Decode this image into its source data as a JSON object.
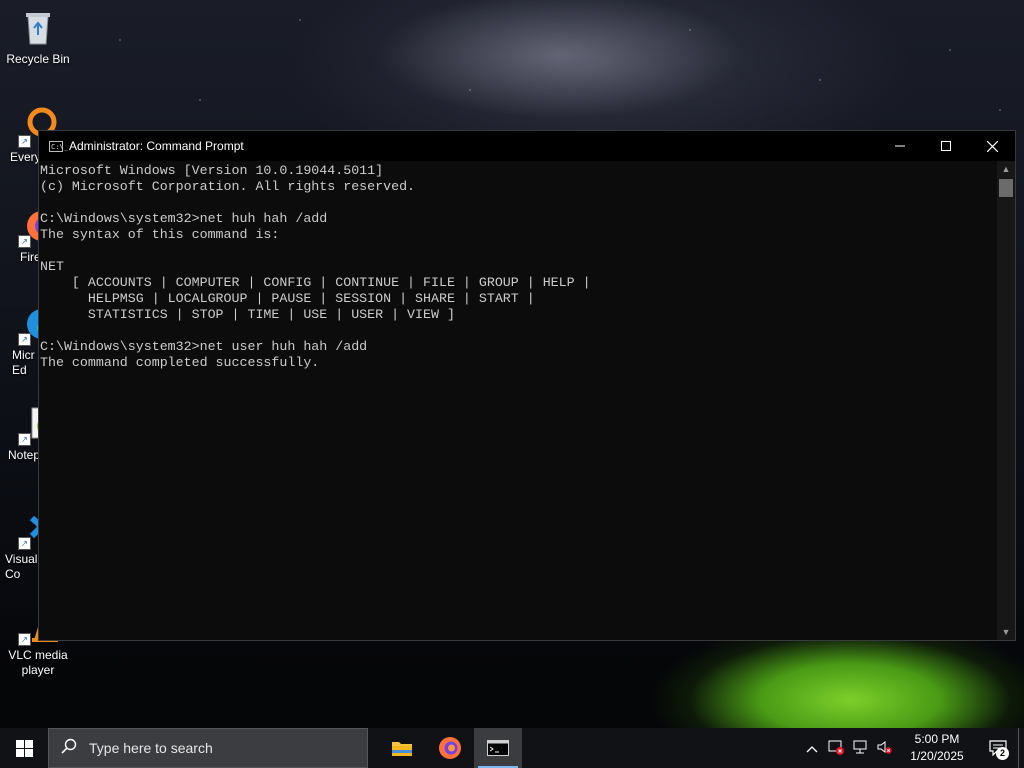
{
  "desktop": {
    "icons": [
      {
        "label": "Recycle Bin"
      },
      {
        "label": "Every"
      },
      {
        "label": "Fire"
      },
      {
        "label": "Micr\nEd"
      },
      {
        "label": "Notep"
      },
      {
        "label": "Visual\nCo"
      },
      {
        "label": "VLC media\nplayer"
      }
    ]
  },
  "window": {
    "title": "Administrator: Command Prompt",
    "controls": {
      "minimize": "—",
      "maximize": "☐",
      "close": "✕"
    },
    "console_text": "Microsoft Windows [Version 10.0.19044.5011]\n(c) Microsoft Corporation. All rights reserved.\n\nC:\\Windows\\system32>net huh hah /add\nThe syntax of this command is:\n\nNET\n    [ ACCOUNTS | COMPUTER | CONFIG | CONTINUE | FILE | GROUP | HELP |\n      HELPMSG | LOCALGROUP | PAUSE | SESSION | SHARE | START |\n      STATISTICS | STOP | TIME | USE | USER | VIEW ]\n\nC:\\Windows\\system32>net user huh hah /add\nThe command completed successfully.\n"
  },
  "taskbar": {
    "search_placeholder": "Type here to search",
    "apps": [
      {
        "name": "File Explorer",
        "icon": "folder-icon"
      },
      {
        "name": "Firefox",
        "icon": "firefox-icon"
      },
      {
        "name": "Command Prompt",
        "icon": "cmd-icon",
        "active": true
      }
    ],
    "time": "5:00 PM",
    "date": "1/20/2025",
    "notification_count": "2"
  },
  "colors": {
    "console_bg": "#0c0c0c",
    "console_fg": "#cccccc",
    "taskbar_bg": "#101216",
    "active_indicator": "#7db8f0"
  }
}
